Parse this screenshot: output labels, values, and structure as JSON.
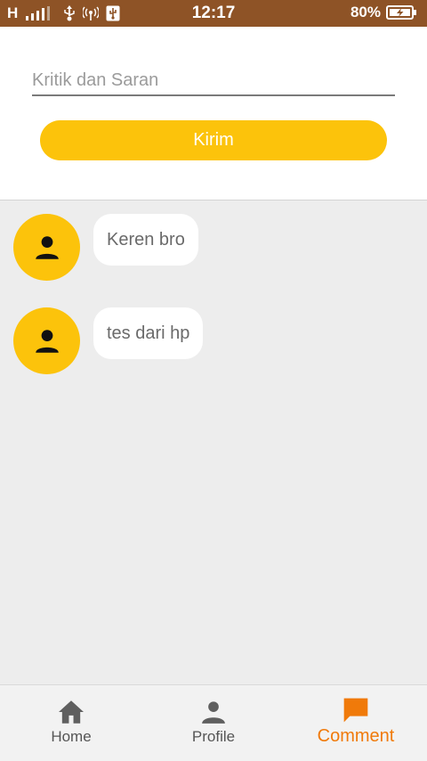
{
  "status_bar": {
    "network": "H",
    "time": "12:17",
    "battery": "80%"
  },
  "form": {
    "input_placeholder": "Kritik dan Saran",
    "input_value": "",
    "send_label": "Kirim"
  },
  "comments": [
    {
      "text": "Keren bro"
    },
    {
      "text": "tes dari hp"
    }
  ],
  "nav": {
    "items": [
      {
        "label": "Home",
        "icon": "home-icon"
      },
      {
        "label": "Profile",
        "icon": "person-icon"
      },
      {
        "label": "Comment",
        "icon": "comment-icon",
        "active": true
      }
    ]
  },
  "colors": {
    "status_bar": "#8e5326",
    "accent": "#fcc30b",
    "active_nav": "#f07a0a"
  }
}
